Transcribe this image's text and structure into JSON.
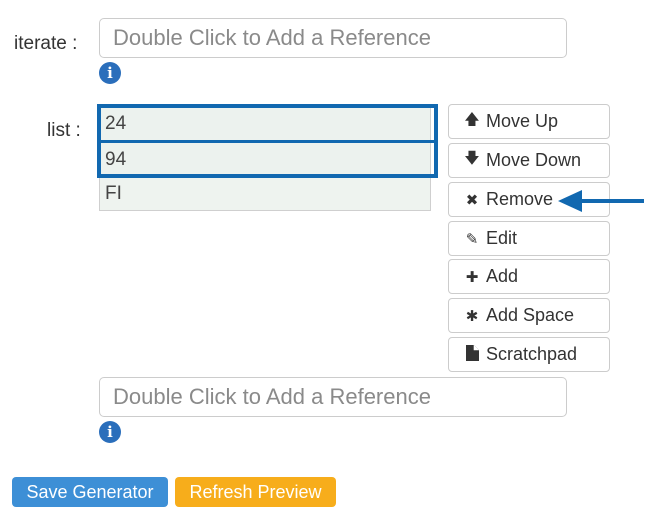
{
  "iterate": {
    "label": "iterate :",
    "placeholder": "Double Click to Add a Reference",
    "info_icon": "info-circle"
  },
  "list": {
    "label": "list :",
    "items": [
      "24",
      "94",
      "FI"
    ]
  },
  "buttons": {
    "move_up": {
      "label": "Move Up",
      "icon": "arrow-up"
    },
    "move_down": {
      "label": "Move Down",
      "icon": "arrow-down"
    },
    "remove": {
      "label": "Remove",
      "icon": "times"
    },
    "edit": {
      "label": "Edit",
      "icon": "pencil"
    },
    "add": {
      "label": "Add",
      "icon": "plus"
    },
    "add_space": {
      "label": "Add Space",
      "icon": "asterisk"
    },
    "scratchpad": {
      "label": "Scratchpad",
      "icon": "file"
    }
  },
  "reference2": {
    "placeholder": "Double Click to Add a Reference",
    "info_icon": "info-circle"
  },
  "actions": {
    "save_generator": "Save Generator",
    "refresh_preview": "Refresh Preview"
  },
  "colors": {
    "primary": "#3d8fd6",
    "warning": "#f7ad1b",
    "highlight": "#1168b0",
    "list_bg": "#eef3ef",
    "info": "#2a6ebb"
  }
}
